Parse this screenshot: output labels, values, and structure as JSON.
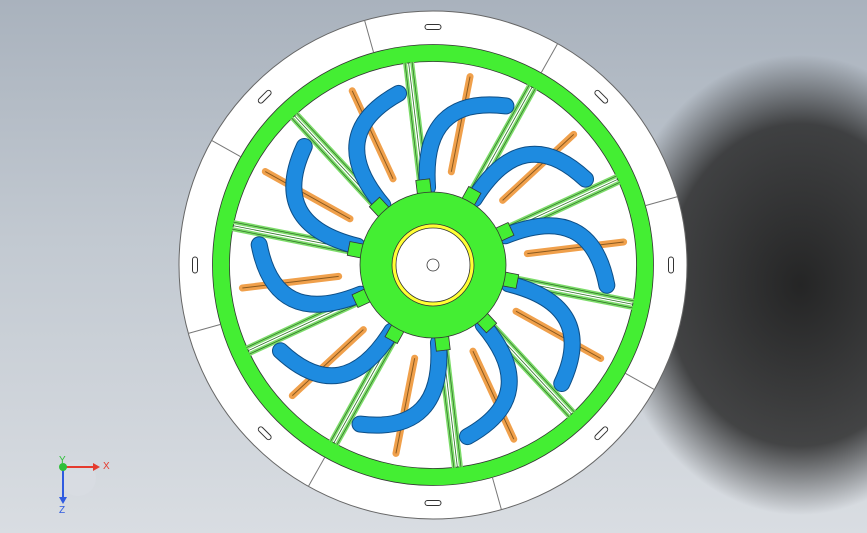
{
  "viewport": {
    "background": "#c2c9d1"
  },
  "model": {
    "colors": {
      "outer_ring": "#ffffff",
      "rim": "#44ee33",
      "hub": "#44ee33",
      "bore_ring": "#ffff33",
      "spring_blade": "#1e8be0",
      "spoke_frame": "#7ddc6a",
      "pin_accent": "#f0a04b",
      "shadow": "#1c1c1c"
    },
    "spoke_count": 10,
    "outer_segment_count": 8
  },
  "triad": {
    "x_label": "X",
    "y_label": "Y",
    "z_label": "Z",
    "x_color": "#e53b2e",
    "y_color": "#2fbf3a",
    "z_color": "#2f5be0"
  }
}
